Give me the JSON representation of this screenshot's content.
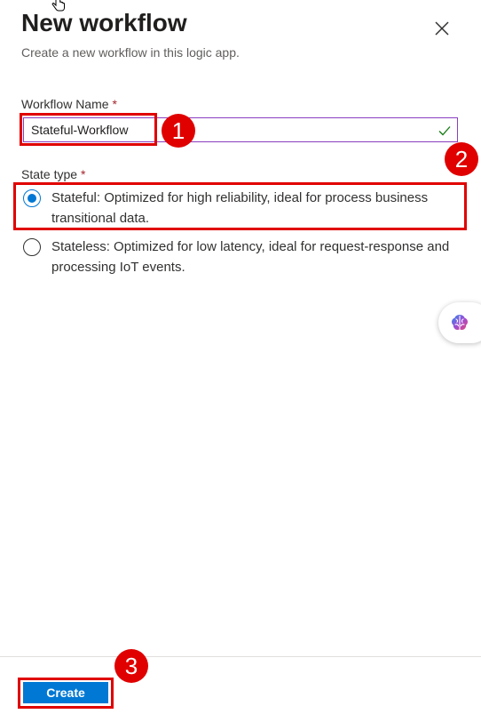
{
  "panel": {
    "title": "New workflow",
    "subtitle": "Create a new workflow in this logic app."
  },
  "form": {
    "workflow_name_label": "Workflow Name",
    "required_marker": "*",
    "workflow_name_value": "Stateful-Workflow",
    "state_type_label": "State type",
    "state_options": [
      {
        "label": "Stateful: Optimized for high reliability, ideal for process business transitional data.",
        "selected": true
      },
      {
        "label": "Stateless: Optimized for low latency, ideal for request-response and processing IoT events.",
        "selected": false
      }
    ]
  },
  "footer": {
    "create_label": "Create"
  },
  "annotations": {
    "badge_1": "1",
    "badge_2": "2",
    "badge_3": "3",
    "color": "#e00000"
  },
  "icons": {
    "close": "close-icon",
    "valid": "checkmark-icon",
    "copilot": "copilot-brain-icon",
    "cursor": "hand-cursor-icon"
  },
  "colors": {
    "accent": "#0078d4",
    "input_border": "#8a3fbf",
    "valid_check": "#107c10",
    "required": "#a4262c"
  }
}
